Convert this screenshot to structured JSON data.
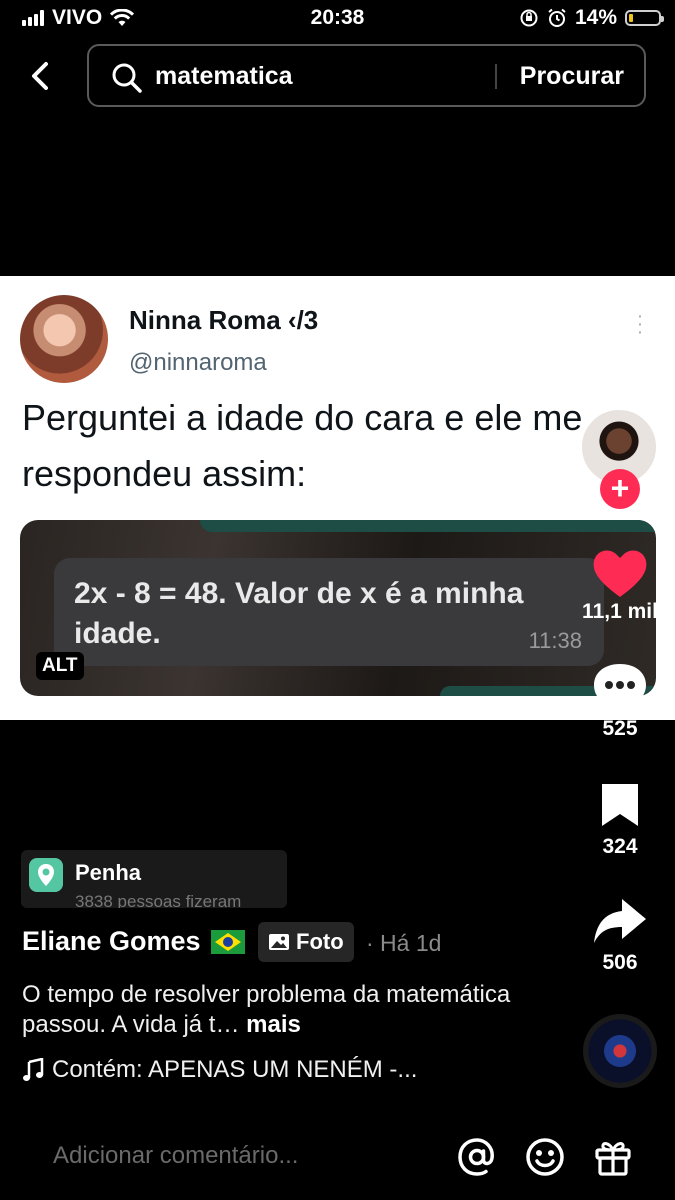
{
  "status_bar": {
    "carrier": "VIVO",
    "time": "20:38",
    "battery": "14%",
    "battery_level": 0.14,
    "battery_color": "#f0c419"
  },
  "search": {
    "query": "matematica",
    "button": "Procurar",
    "icons": [
      "back-icon",
      "search-icon"
    ]
  },
  "tweet": {
    "name": "Ninna Roma ‹/3",
    "handle": "@ninnaroma",
    "text": "Perguntei a idade do cara e ele me respondeu assim:",
    "image": {
      "message": "2x - 8 = 48. Valor de x é a minha idade.",
      "time": "11:38",
      "alt_badge": "ALT"
    }
  },
  "rail": {
    "likes": "11,1 mil",
    "comments": "525",
    "saves": "324",
    "shares": "506",
    "like_color": "#fe2c55",
    "follow_color": "#fe2c55"
  },
  "location": {
    "name": "Penha",
    "subtitle": "3838 pessoas fizeram"
  },
  "post": {
    "author": "Eliane Gomes",
    "type_badge": "Foto",
    "time_ago": "· Há 1d",
    "caption": "O tempo de resolver problema da matemática passou. A vida já t…",
    "more": "mais",
    "music": "Contém: APENAS UM NENÉM -..."
  },
  "comment_bar": {
    "placeholder": "Adicionar comentário...",
    "icons": [
      "at-icon",
      "emoji-icon",
      "gift-icon"
    ]
  }
}
